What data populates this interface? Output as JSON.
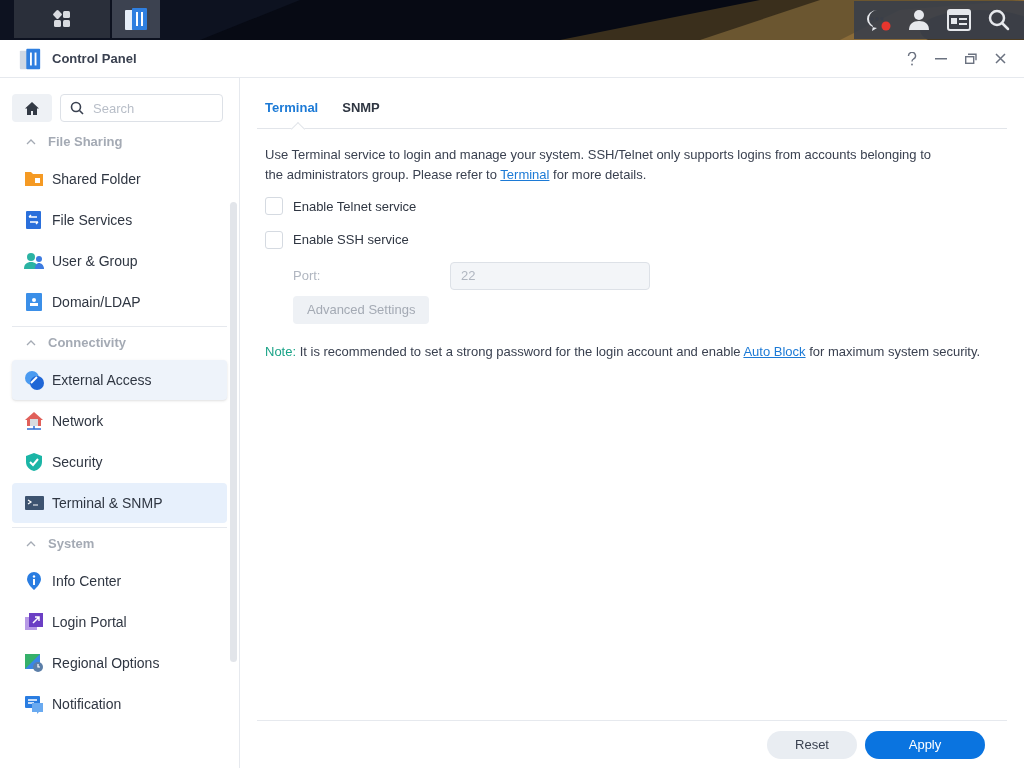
{
  "window": {
    "title": "Control Panel"
  },
  "sidebar": {
    "search": {
      "placeholder": "Search"
    },
    "groups": [
      {
        "title": "File Sharing",
        "expanded": true,
        "items": [
          {
            "label": "Shared Folder",
            "selected": false,
            "hovered": false
          },
          {
            "label": "File Services",
            "selected": false,
            "hovered": false
          },
          {
            "label": "User & Group",
            "selected": false,
            "hovered": false
          },
          {
            "label": "Domain/LDAP",
            "selected": false,
            "hovered": false
          }
        ]
      },
      {
        "title": "Connectivity",
        "expanded": true,
        "items": [
          {
            "label": "External Access",
            "selected": false,
            "hovered": true
          },
          {
            "label": "Network",
            "selected": false,
            "hovered": false
          },
          {
            "label": "Security",
            "selected": false,
            "hovered": false
          },
          {
            "label": "Terminal & SNMP",
            "selected": true,
            "hovered": false
          }
        ]
      },
      {
        "title": "System",
        "expanded": true,
        "items": [
          {
            "label": "Info Center",
            "selected": false,
            "hovered": false
          },
          {
            "label": "Login Portal",
            "selected": false,
            "hovered": false
          },
          {
            "label": "Regional Options",
            "selected": false,
            "hovered": false
          },
          {
            "label": "Notification",
            "selected": false,
            "hovered": false
          }
        ]
      }
    ]
  },
  "tabs": [
    {
      "label": "Terminal",
      "selected": true
    },
    {
      "label": "SNMP",
      "selected": false
    }
  ],
  "description": {
    "before": "Use Terminal service to login and manage your system. SSH/Telnet only supports logins from accounts belonging to the administrators group. Please refer to ",
    "link": "Terminal",
    "after": " for more details."
  },
  "options": [
    {
      "label": "Enable Telnet service",
      "checked": false
    },
    {
      "label": "Enable SSH service",
      "checked": false
    }
  ],
  "port": {
    "label": "Port:",
    "value": "22",
    "disabled": true
  },
  "advanced_button": {
    "label": "Advanced Settings",
    "disabled": true
  },
  "note": {
    "label": "Note:",
    "before": " It is recommended to set a strong password for the login account and enable ",
    "link": "Auto Block",
    "after": " for maximum system security."
  },
  "buttons": [
    {
      "label": "Reset",
      "kind": "secondary"
    },
    {
      "label": "Apply",
      "kind": "primary"
    }
  ]
}
